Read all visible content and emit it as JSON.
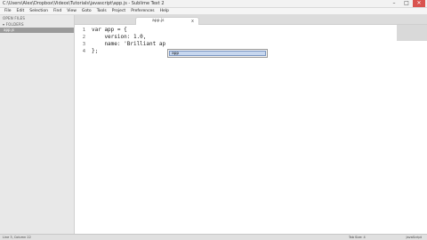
{
  "window": {
    "title": "C:\\Users\\Alex\\Dropbox\\Videos\\Tutorials\\javascript\\app.js - Sublime Text 2",
    "controls": [
      "–",
      "□",
      "✕"
    ]
  },
  "menu": [
    "File",
    "Edit",
    "Selection",
    "Find",
    "View",
    "Goto",
    "Tools",
    "Project",
    "Preferences",
    "Help"
  ],
  "sidebar": {
    "header": "OPEN FILES",
    "folder": "▾ FOLDERS",
    "files": [
      {
        "name": "app.js",
        "active": true
      }
    ]
  },
  "tab": {
    "label": "app.js",
    "close": "x"
  },
  "editor": {
    "lines": [
      {
        "no": "1",
        "text": "var app = {"
      },
      {
        "no": "2",
        "text": "    version: 1.0,"
      },
      {
        "no": "3",
        "text": "    name: 'Brilliant ap"
      },
      {
        "no": "4",
        "text": "};"
      }
    ]
  },
  "autocomplete": {
    "items": [
      "app"
    ]
  },
  "status": {
    "left": "Line 3, Column 22",
    "mid": "Tab Size: 4",
    "right": "JavaScript"
  }
}
